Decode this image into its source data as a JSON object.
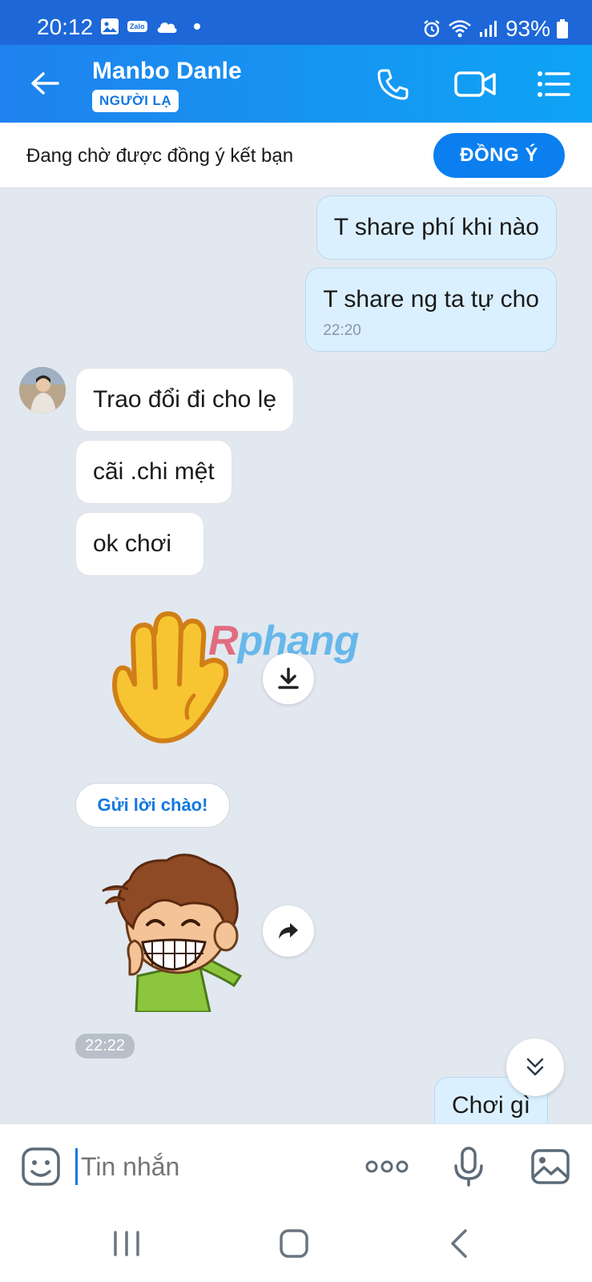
{
  "status_bar": {
    "time": "20:12",
    "zalo_mini": "Zalo",
    "battery": "93%"
  },
  "header": {
    "name": "Manbo Danle",
    "badge": "NGƯỜI LẠ"
  },
  "friend_request": {
    "text": "Đang chờ được đồng ý kết bạn",
    "accept_label": "ĐỒNG Ý"
  },
  "messages": {
    "m1": "T share phí khi nào",
    "m2": "T share ng ta tự cho",
    "m2_time": "22:20",
    "m3": "Trao đổi đi cho lẹ",
    "m4": "cãi .chi mệt",
    "m5": "ok chơi",
    "m6": "Chơi gì"
  },
  "watermark": {
    "r": "R",
    "rest": "phang"
  },
  "greet_button": "Gửi lời chào!",
  "time_pill": "22:22",
  "composer": {
    "placeholder": "Tin nhắn"
  },
  "colors": {
    "accent": "#0b7ff0",
    "header_start": "#1f82ee",
    "header_end": "#0ea4f5",
    "chat_bg": "#e2e8f0",
    "my_bubble": "#dbf0ff"
  }
}
